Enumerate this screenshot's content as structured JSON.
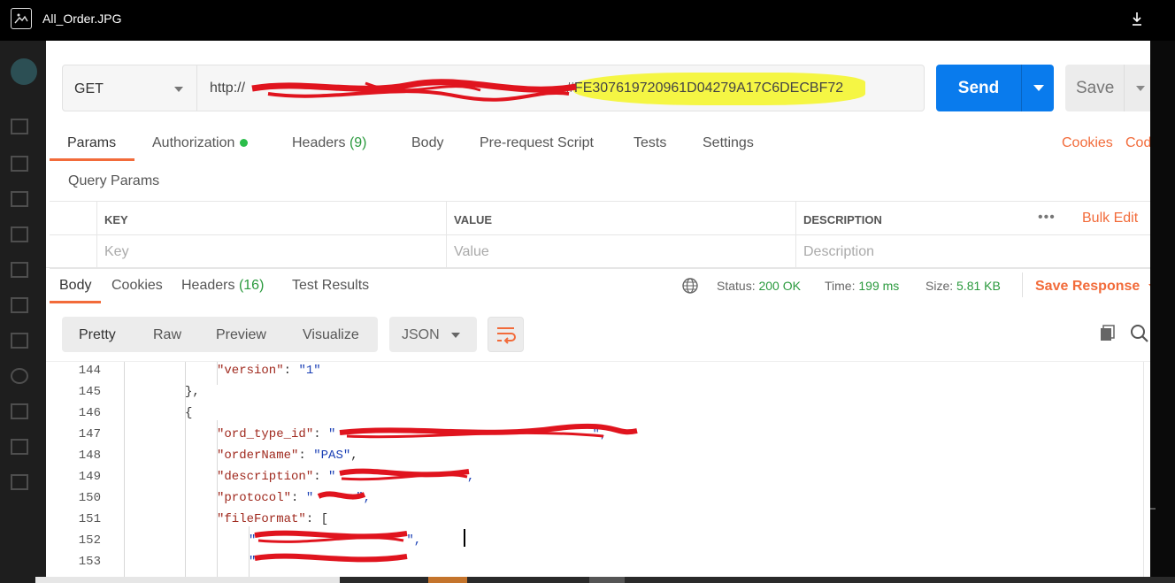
{
  "window": {
    "title": "All_Order.JPG"
  },
  "request": {
    "method": "GET",
    "url_prefix": "http://",
    "url_visible_suffix": "#FE307619720961D04279A17C6DECBF72",
    "send_label": "Send",
    "save_label": "Save"
  },
  "request_tabs": {
    "params": "Params",
    "authorization": "Authorization",
    "headers": "Headers",
    "headers_count": "(9)",
    "body": "Body",
    "prerequest": "Pre-request Script",
    "tests": "Tests",
    "settings": "Settings",
    "cookies": "Cookies",
    "code": "Cod"
  },
  "query_params": {
    "title": "Query Params",
    "col_key": "KEY",
    "col_value": "VALUE",
    "col_description": "DESCRIPTION",
    "more": "•••",
    "bulk_edit": "Bulk Edit",
    "ph_key": "Key",
    "ph_value": "Value",
    "ph_description": "Description"
  },
  "response_tabs": {
    "body": "Body",
    "cookies": "Cookies",
    "headers": "Headers",
    "headers_count": "(16)",
    "test_results": "Test Results"
  },
  "response_status": {
    "status_label": "Status:",
    "status_value": "200 OK",
    "time_label": "Time:",
    "time_value": "199 ms",
    "size_label": "Size:",
    "size_value": "5.81 KB",
    "save_response": "Save Response"
  },
  "view_options": {
    "pretty": "Pretty",
    "raw": "Raw",
    "preview": "Preview",
    "visualize": "Visualize",
    "format": "JSON"
  },
  "code_lines": [
    {
      "num": "144",
      "indent": 2,
      "key": "\"version\"",
      "sep": ": ",
      "val": "\"1\"",
      "tail": ""
    },
    {
      "num": "145",
      "indent": 1,
      "raw": "},"
    },
    {
      "num": "146",
      "indent": 1,
      "raw": "{"
    },
    {
      "num": "147",
      "indent": 2,
      "key": "\"ord_type_id\"",
      "sep": ": ",
      "val": "\"",
      "tail": "\","
    },
    {
      "num": "148",
      "indent": 2,
      "key": "\"orderName\"",
      "sep": ": ",
      "val": "\"PAS\"",
      "tail": ","
    },
    {
      "num": "149",
      "indent": 2,
      "key": "\"description\"",
      "sep": ": ",
      "val": "\"",
      "tail": "\","
    },
    {
      "num": "150",
      "indent": 2,
      "key": "\"protocol\"",
      "sep": ": ",
      "val": "\"",
      "tail": "\","
    },
    {
      "num": "151",
      "indent": 2,
      "key": "\"fileFormat\"",
      "sep": ": ",
      "val": "",
      "tail": "["
    },
    {
      "num": "152",
      "indent": 3,
      "val": "\"",
      "tail": "\","
    },
    {
      "num": "153",
      "indent": 3,
      "val": "\"",
      "tail": "\""
    }
  ],
  "colors": {
    "accent": "#f26b3a",
    "send": "#097bed",
    "status_ok": "#2b9a3e",
    "highlight": "#f4f53a",
    "redaction": "#e0141e"
  }
}
